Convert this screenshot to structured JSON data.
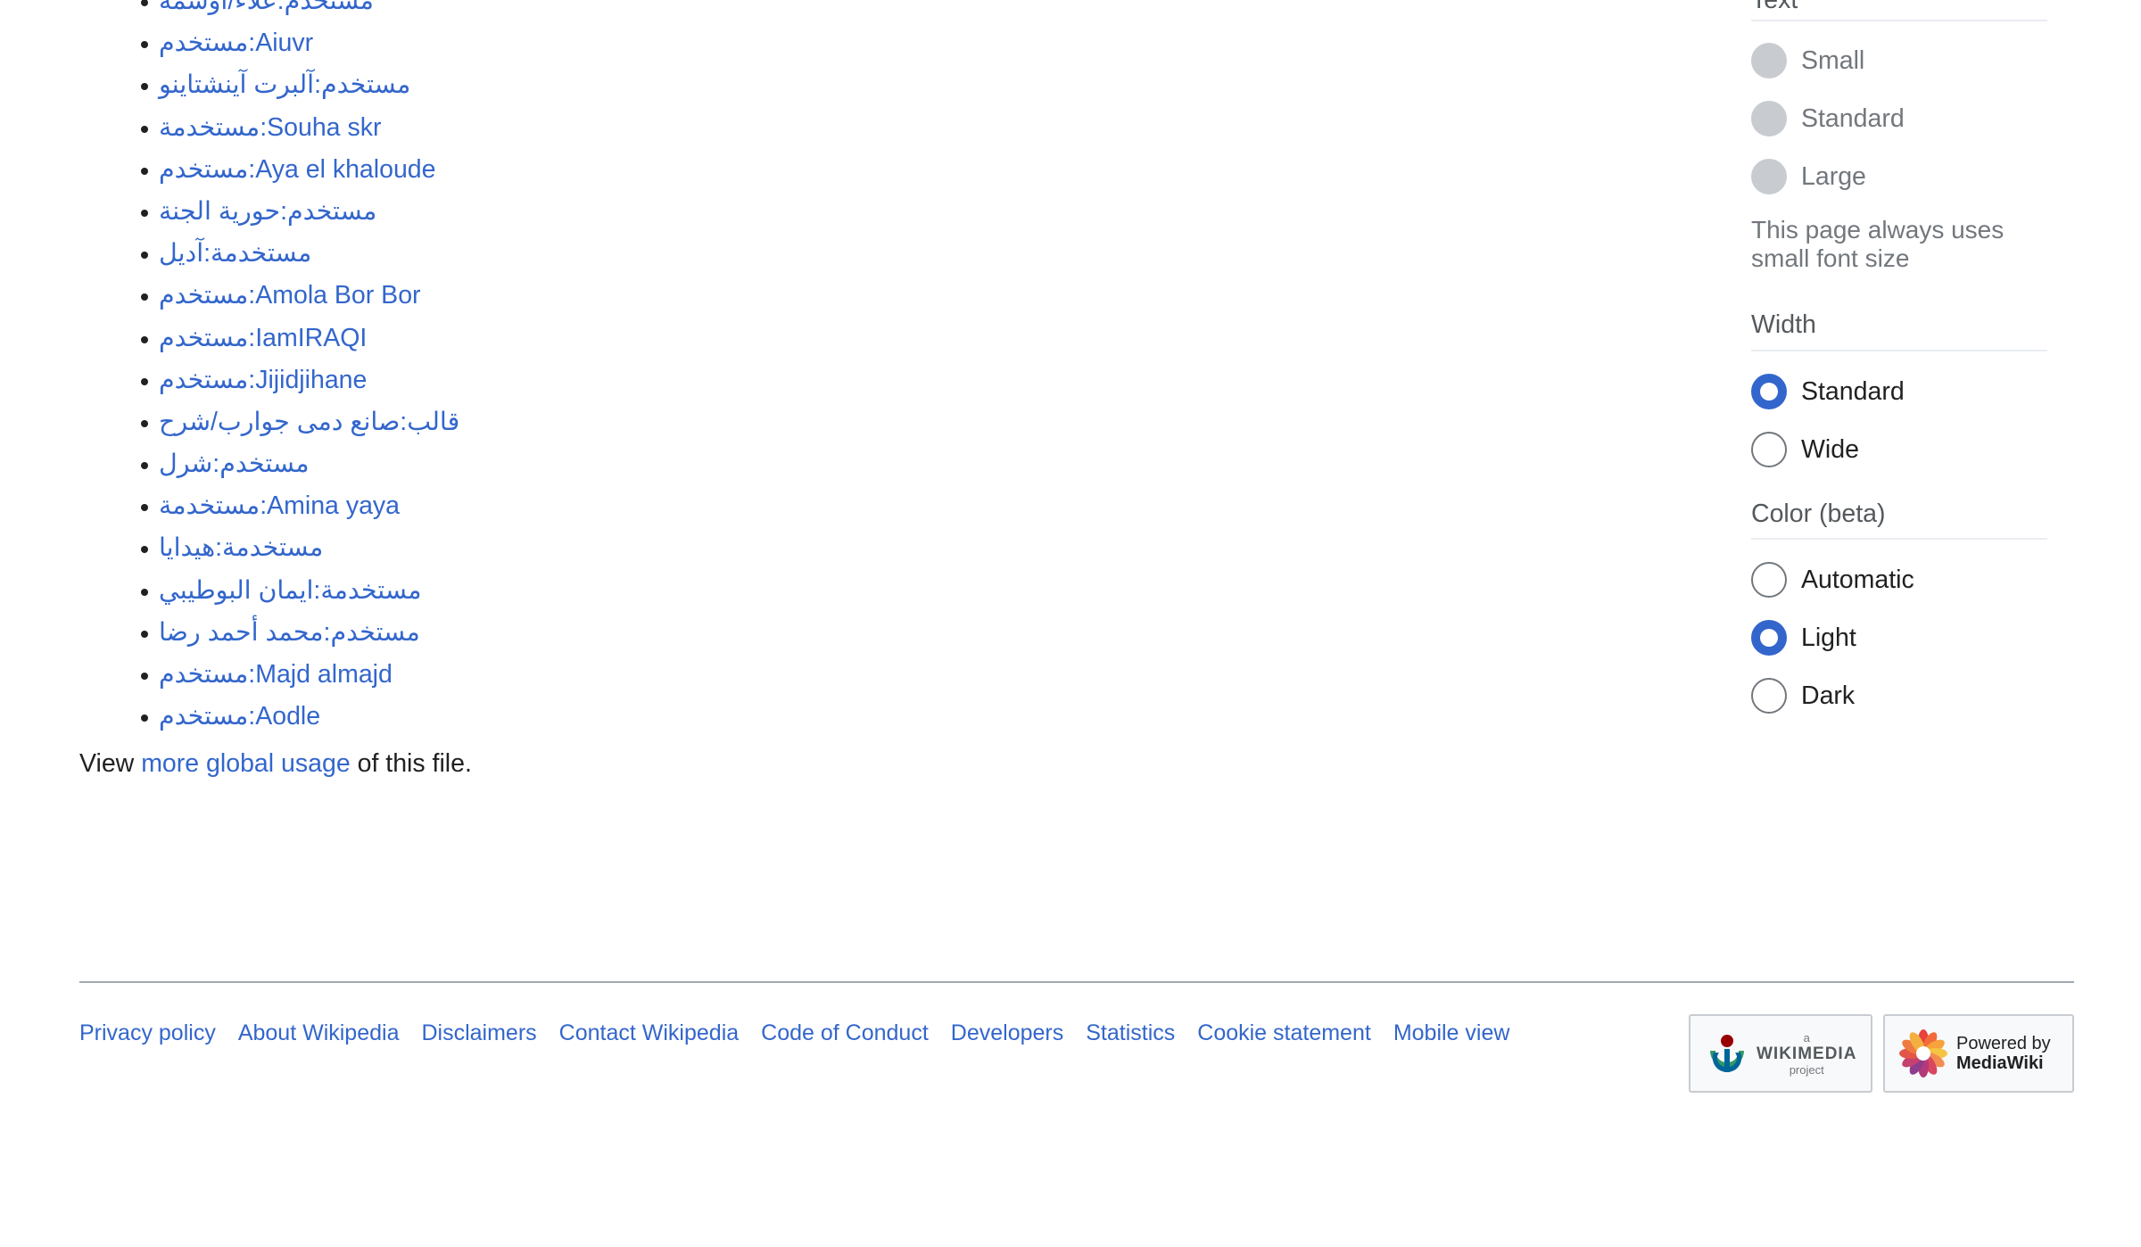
{
  "usage_list": [
    {
      "label": "مستخدم:علاء/أوسمة"
    },
    {
      "label": "مستخدم:Aiuvr"
    },
    {
      "label": "مستخدم:آلبرت آينشتاينو"
    },
    {
      "label": "مستخدمة:Souha skr"
    },
    {
      "label": "مستخدم:Aya el khaloude"
    },
    {
      "label": "مستخدم:حورية الجنة"
    },
    {
      "label": "مستخدمة:آديل"
    },
    {
      "label": "مستخدم:Amola Bor Bor"
    },
    {
      "label": "مستخدم:IamIRAQI"
    },
    {
      "label": "مستخدم:Jijidjihane"
    },
    {
      "label": "قالب:صانع دمى جوارب/شرح"
    },
    {
      "label": "مستخدم:شرل"
    },
    {
      "label": "مستخدمة:Amina yaya"
    },
    {
      "label": "مستخدمة:هيدايا"
    },
    {
      "label": "مستخدمة:ايمان البوطيبي"
    },
    {
      "label": "مستخدم:محمد أحمد رضا"
    },
    {
      "label": "مستخدم:Majd almajd"
    },
    {
      "label": "مستخدم:Aodle"
    }
  ],
  "more_usage": {
    "prefix": "View ",
    "link": "more global usage",
    "suffix": " of this file."
  },
  "appearance": {
    "text": {
      "title": "Text",
      "options": [
        "Small",
        "Standard",
        "Large"
      ],
      "note": "This page always uses small font size"
    },
    "width": {
      "title": "Width",
      "options": [
        "Standard",
        "Wide"
      ],
      "selected": "Standard"
    },
    "color": {
      "title": "Color (beta)",
      "options": [
        "Automatic",
        "Light",
        "Dark"
      ],
      "selected": "Light"
    }
  },
  "footer": {
    "links": [
      "Privacy policy",
      "About Wikipedia",
      "Disclaimers",
      "Contact Wikipedia",
      "Code of Conduct",
      "Developers",
      "Statistics",
      "Cookie statement",
      "Mobile view"
    ],
    "wikimedia_badge": {
      "small": "a",
      "name": "WIKIMEDIA",
      "sub": "project"
    },
    "mediawiki_badge": {
      "line1": "Powered by",
      "line2": "MediaWiki"
    }
  },
  "colors": {
    "link": "#3366cc",
    "text": "#202122",
    "muted": "#72777d",
    "rule": "#a2a9b1"
  }
}
